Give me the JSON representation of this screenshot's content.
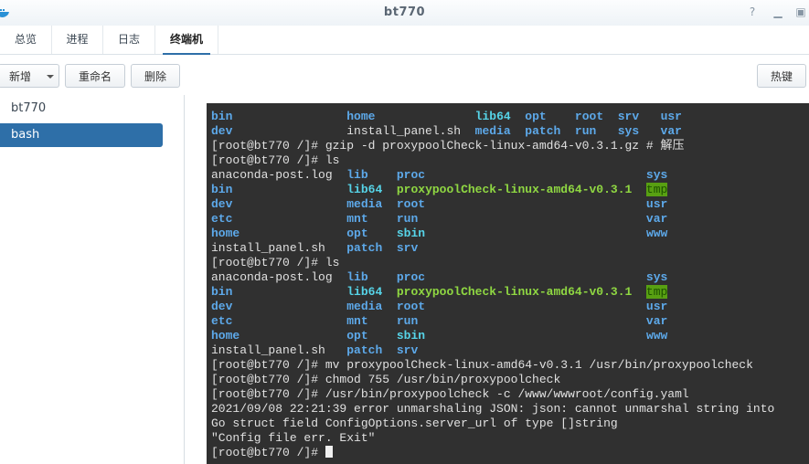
{
  "window": {
    "title": "bt770"
  },
  "tabs": [
    {
      "label": "总览"
    },
    {
      "label": "进程"
    },
    {
      "label": "日志"
    },
    {
      "label": "终端机"
    }
  ],
  "toolbar": {
    "new_label": "新增",
    "rename_label": "重命名",
    "delete_label": "删除",
    "hotkey_label": "热键"
  },
  "sidebar": {
    "items": [
      {
        "label": "bt770"
      },
      {
        "label": "bash"
      }
    ]
  },
  "terminal": {
    "cursor": true,
    "lines": [
      [
        [
          "bin",
          "dir",
          0
        ],
        [
          "home",
          "dir",
          19
        ],
        [
          "lib64",
          "lnk",
          37
        ],
        [
          "opt",
          "dir",
          44
        ],
        [
          "root",
          "dir",
          51
        ],
        [
          "srv",
          "dir",
          57
        ],
        [
          "usr",
          "dir",
          63
        ]
      ],
      [
        [
          "dev",
          "dir",
          0
        ],
        [
          "install_panel.sh",
          "",
          19
        ],
        [
          "media",
          "dir",
          37
        ],
        [
          "patch",
          "dir",
          44
        ],
        [
          "run",
          "dir",
          51
        ],
        [
          "sys",
          "dir",
          57
        ],
        [
          "var",
          "dir",
          63
        ]
      ],
      [
        [
          "[root@bt770 /]# gzip -d proxypoolCheck-linux-amd64-v0.3.1.gz # 解压",
          "",
          0
        ]
      ],
      [
        [
          "[root@bt770 /]# ls",
          "",
          0
        ]
      ],
      [
        [
          "anaconda-post.log",
          "",
          0
        ],
        [
          "lib",
          "dir",
          19
        ],
        [
          "proc",
          "dir",
          26
        ],
        [
          "sys",
          "dir",
          61
        ]
      ],
      [
        [
          "bin",
          "dir",
          0
        ],
        [
          "lib64",
          "lnk",
          19
        ],
        [
          "proxypoolCheck-linux-amd64-v0.3.1",
          "exe",
          26
        ],
        [
          "tmp",
          "tmp",
          61
        ]
      ],
      [
        [
          "dev",
          "dir",
          0
        ],
        [
          "media",
          "dir",
          19
        ],
        [
          "root",
          "dir",
          26
        ],
        [
          "usr",
          "dir",
          61
        ]
      ],
      [
        [
          "etc",
          "dir",
          0
        ],
        [
          "mnt",
          "dir",
          19
        ],
        [
          "run",
          "dir",
          26
        ],
        [
          "var",
          "dir",
          61
        ]
      ],
      [
        [
          "home",
          "dir",
          0
        ],
        [
          "opt",
          "dir",
          19
        ],
        [
          "sbin",
          "lnk",
          26
        ],
        [
          "www",
          "dir",
          61
        ]
      ],
      [
        [
          "install_panel.sh",
          "",
          0
        ],
        [
          "patch",
          "dir",
          19
        ],
        [
          "srv",
          "dir",
          26
        ]
      ],
      [
        [
          "[root@bt770 /]# ls",
          "",
          0
        ]
      ],
      [
        [
          "anaconda-post.log",
          "",
          0
        ],
        [
          "lib",
          "dir",
          19
        ],
        [
          "proc",
          "dir",
          26
        ],
        [
          "sys",
          "dir",
          61
        ]
      ],
      [
        [
          "bin",
          "dir",
          0
        ],
        [
          "lib64",
          "lnk",
          19
        ],
        [
          "proxypoolCheck-linux-amd64-v0.3.1",
          "exe",
          26
        ],
        [
          "tmp",
          "tmp",
          61
        ]
      ],
      [
        [
          "dev",
          "dir",
          0
        ],
        [
          "media",
          "dir",
          19
        ],
        [
          "root",
          "dir",
          26
        ],
        [
          "usr",
          "dir",
          61
        ]
      ],
      [
        [
          "etc",
          "dir",
          0
        ],
        [
          "mnt",
          "dir",
          19
        ],
        [
          "run",
          "dir",
          26
        ],
        [
          "var",
          "dir",
          61
        ]
      ],
      [
        [
          "home",
          "dir",
          0
        ],
        [
          "opt",
          "dir",
          19
        ],
        [
          "sbin",
          "lnk",
          26
        ],
        [
          "www",
          "dir",
          61
        ]
      ],
      [
        [
          "install_panel.sh",
          "",
          0
        ],
        [
          "patch",
          "dir",
          19
        ],
        [
          "srv",
          "dir",
          26
        ]
      ],
      [
        [
          "[root@bt770 /]# mv proxypoolCheck-linux-amd64-v0.3.1 /usr/bin/proxypoolcheck",
          "",
          0
        ]
      ],
      [
        [
          "[root@bt770 /]# chmod 755 /usr/bin/proxypoolcheck",
          "",
          0
        ]
      ],
      [
        [
          "[root@bt770 /]# /usr/bin/proxypoolcheck -c /www/wwwroot/config.yaml",
          "",
          0
        ]
      ],
      [
        [
          "2021/09/08 22:21:39 error unmarshaling JSON: json: cannot unmarshal string into",
          "",
          0
        ]
      ],
      [
        [
          "Go struct field ConfigOptions.server_url of type []string",
          "",
          0
        ]
      ],
      [
        [
          "\"Config file err. Exit\"",
          "",
          0
        ]
      ],
      [
        [
          "[root@bt770 /]# ",
          "",
          0
        ]
      ]
    ]
  }
}
